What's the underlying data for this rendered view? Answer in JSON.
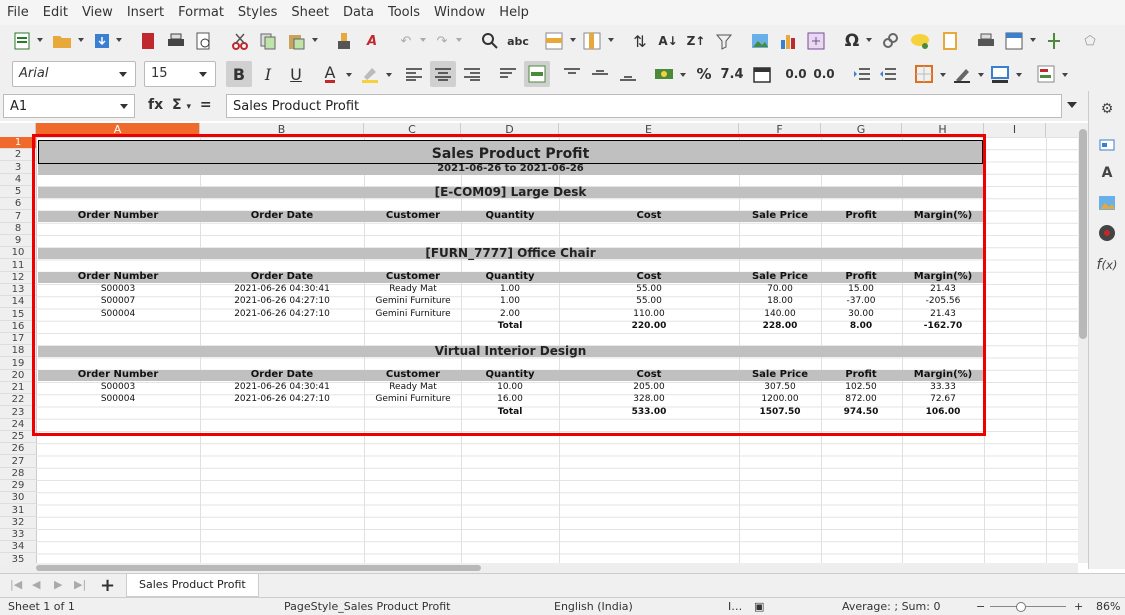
{
  "menu": [
    "File",
    "Edit",
    "View",
    "Insert",
    "Format",
    "Styles",
    "Sheet",
    "Data",
    "Tools",
    "Window",
    "Help"
  ],
  "font": {
    "name": "Arial",
    "size": "15"
  },
  "toolbar": {
    "percent": "%",
    "number": "7.4",
    "dec_add": "0.0",
    "dec_del": "0.0",
    "omega": "Ω"
  },
  "namebox": "A1",
  "formula": {
    "fx": "fx",
    "sum": "Σ",
    "eq": "=",
    "content": "Sales Product Profit"
  },
  "columns": [
    "A",
    "B",
    "C",
    "D",
    "E",
    "F",
    "G",
    "H",
    "I"
  ],
  "rows": [
    "1",
    "2",
    "3",
    "4",
    "5",
    "6",
    "7",
    "8",
    "9",
    "10",
    "11",
    "12",
    "13",
    "14",
    "15",
    "16",
    "17",
    "18",
    "19",
    "20",
    "21",
    "22",
    "23",
    "24",
    "25",
    "26",
    "27",
    "28",
    "29",
    "30",
    "31",
    "32",
    "33",
    "34",
    "35"
  ],
  "report": {
    "title": "Sales Product Profit",
    "date_range": "2021-06-26 to 2021-06-26",
    "headers": [
      "Order Number",
      "Order Date",
      "Customer",
      "Quantity",
      "Cost",
      "Sale Price",
      "Profit",
      "Margin(%)"
    ],
    "sections": [
      {
        "name": "[E-COM09] Large Desk",
        "rows": [],
        "total": null
      },
      {
        "name": "[FURN_7777] Office Chair",
        "rows": [
          [
            "S00003",
            "2021-06-26 04:30:41",
            "Ready Mat",
            "1.00",
            "55.00",
            "70.00",
            "15.00",
            "21.43"
          ],
          [
            "S00007",
            "2021-06-26 04:27:10",
            "Gemini Furniture",
            "1.00",
            "55.00",
            "18.00",
            "-37.00",
            "-205.56"
          ],
          [
            "S00004",
            "2021-06-26 04:27:10",
            "Gemini Furniture",
            "2.00",
            "110.00",
            "140.00",
            "30.00",
            "21.43"
          ]
        ],
        "total": [
          "Total",
          "220.00",
          "228.00",
          "8.00",
          "-162.70"
        ]
      },
      {
        "name": "Virtual Interior Design",
        "rows": [
          [
            "S00003",
            "2021-06-26 04:30:41",
            "Ready Mat",
            "10.00",
            "205.00",
            "307.50",
            "102.50",
            "33.33"
          ],
          [
            "S00004",
            "2021-06-26 04:27:10",
            "Gemini Furniture",
            "16.00",
            "328.00",
            "1200.00",
            "872.00",
            "72.67"
          ]
        ],
        "total": [
          "Total",
          "533.00",
          "1507.50",
          "974.50",
          "106.00"
        ]
      }
    ]
  },
  "sheet_tab": "Sheet 1 of 1",
  "tab_name": "Sales Product Profit",
  "status": {
    "page_style": "PageStyle_Sales Product Profit",
    "lang": "English (India)",
    "sum": "Average: ; Sum: 0",
    "zoom": "86%"
  },
  "colors": {
    "active": "#f06a2c",
    "highlight": "#e00000",
    "band": "#c0c0c0"
  }
}
